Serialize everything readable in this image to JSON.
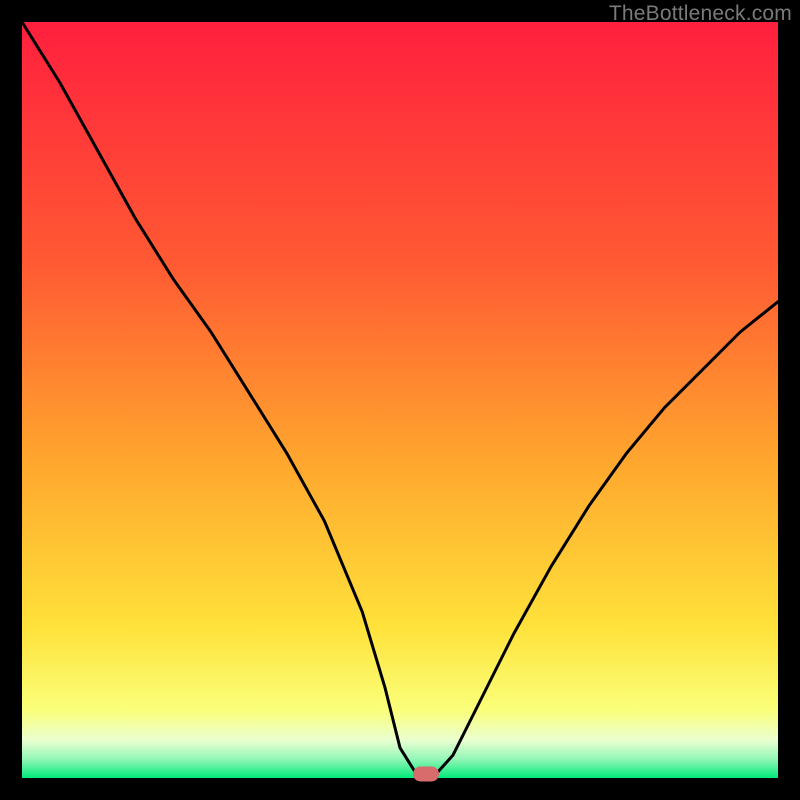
{
  "watermark": "TheBottleneck.com",
  "colors": {
    "frame": "#000000",
    "gradient_top": "#ff1f3e",
    "gradient_mid1": "#ff6a2e",
    "gradient_mid2": "#ffc12c",
    "gradient_mid3": "#ffe84a",
    "gradient_pale": "#f6ffd9",
    "gradient_green": "#00e97a",
    "curve": "#000000",
    "marker": "#d86b6b"
  },
  "chart_data": {
    "type": "line",
    "title": "",
    "xlabel": "",
    "ylabel": "",
    "xlim": [
      0,
      100
    ],
    "ylim": [
      0,
      100
    ],
    "grid": false,
    "series": [
      {
        "name": "bottleneck-curve",
        "x": [
          0,
          5,
          10,
          15,
          20,
          25,
          30,
          35,
          40,
          45,
          48,
          50,
          52,
          53.5,
          55,
          57,
          60,
          65,
          70,
          75,
          80,
          85,
          90,
          95,
          100
        ],
        "y": [
          100,
          92,
          83,
          74,
          66,
          59,
          51,
          43,
          34,
          22,
          12,
          4,
          0.8,
          0.5,
          0.8,
          3,
          9,
          19,
          28,
          36,
          43,
          49,
          54,
          59,
          63
        ]
      }
    ],
    "marker": {
      "x": 53.5,
      "y": 0.5
    },
    "flat_bottom": {
      "x_start": 50,
      "x_end": 57,
      "y": 0.8
    },
    "gradient_stops_y_pct": [
      0,
      32,
      58,
      80,
      91,
      95,
      97.5,
      100
    ],
    "gradient_stops_color": [
      "#ff1f3e",
      "#ff5a33",
      "#ffa62e",
      "#ffe23a",
      "#faff7a",
      "#eaffd0",
      "#93f7b7",
      "#00e97a"
    ]
  }
}
